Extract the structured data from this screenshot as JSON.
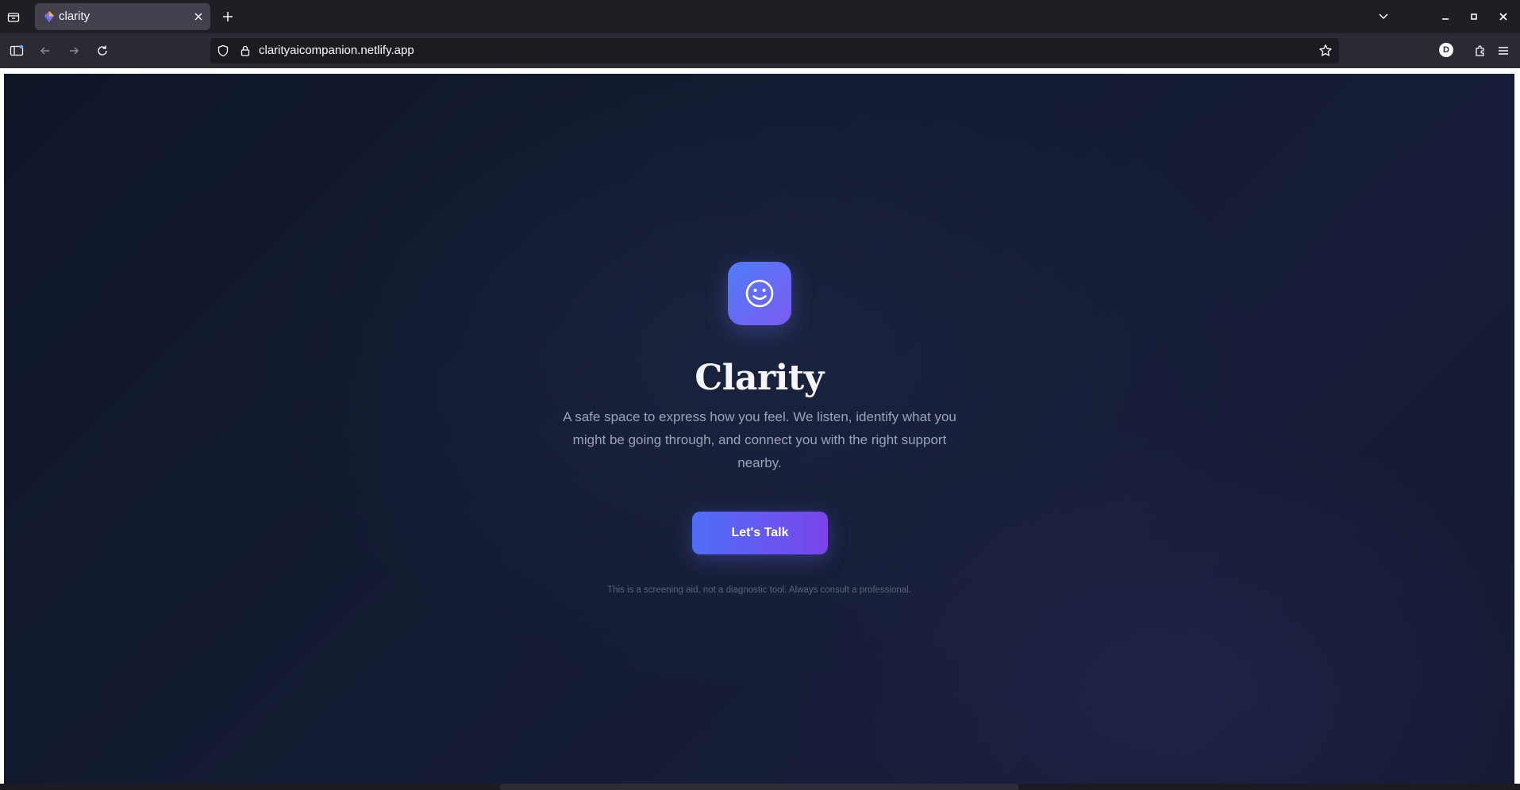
{
  "browser": {
    "tab": {
      "title": "clarity"
    },
    "url": "clarityaicompanion.netlify.app",
    "profile_initial": "D"
  },
  "page": {
    "app_title": "Clarity",
    "tagline": "A safe space to express how you feel. We listen, identify what you might be going through, and connect you with the right support nearby.",
    "cta_label": "Let's Talk",
    "disclaimer": "This is a screening aid, not a diagnostic tool. Always consult a professional.",
    "logo_icon": "smiley-face-icon"
  },
  "colors": {
    "page_bg": "#0f1628",
    "accent_start": "#4f6ef7",
    "accent_end": "#7a44ea",
    "title_text": "#f5f5f7",
    "tagline_text": "#9aa3b8",
    "disclaimer_text": "#5b6378"
  }
}
